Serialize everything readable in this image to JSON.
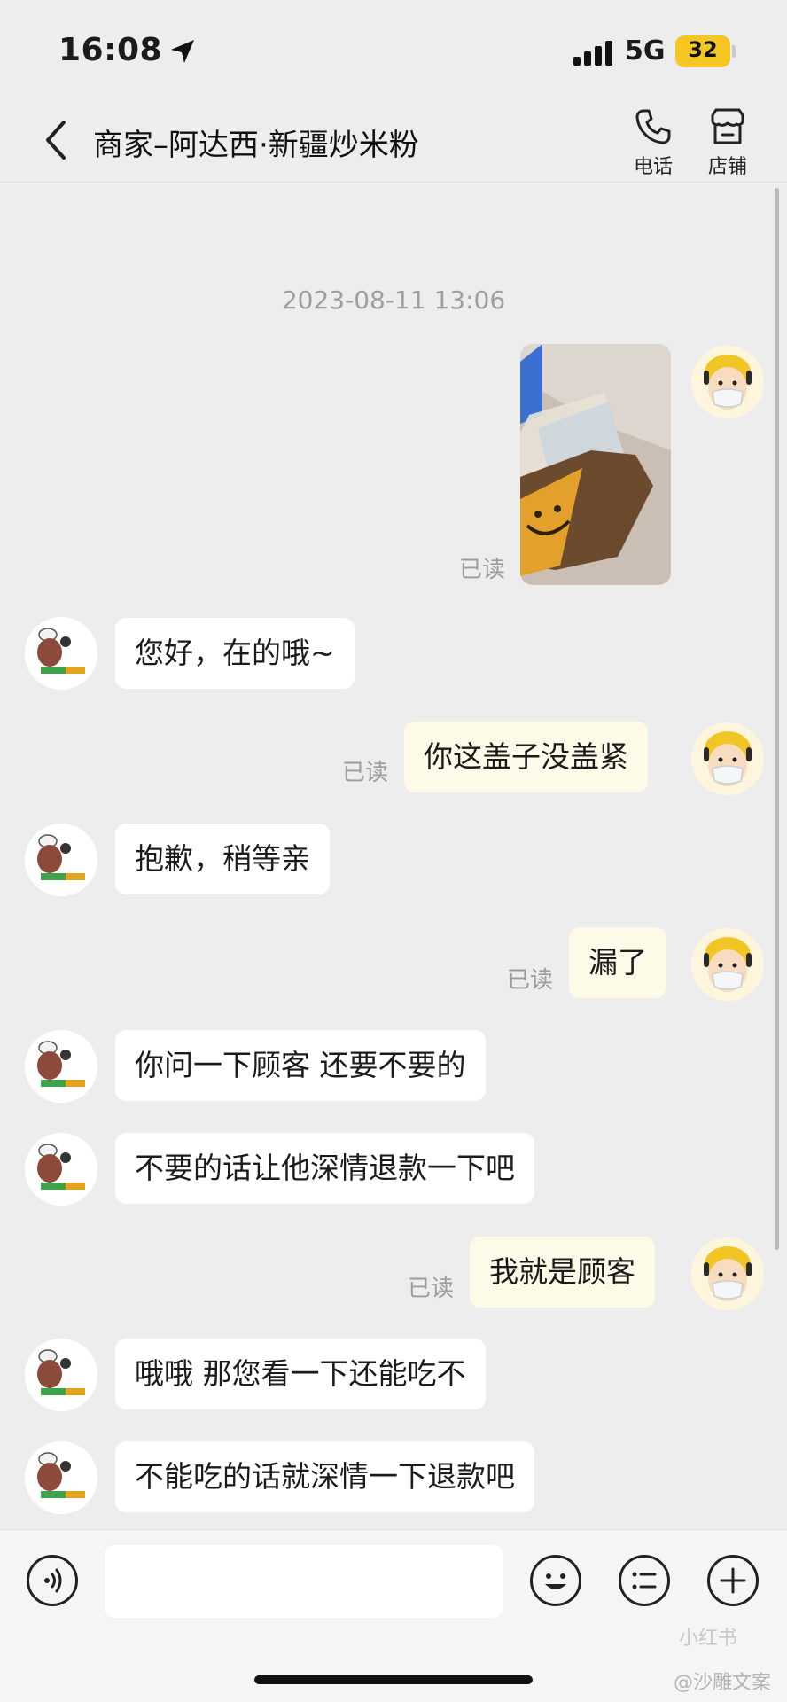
{
  "status_bar": {
    "time": "16:08",
    "network": "5G",
    "battery": "32"
  },
  "header": {
    "title": "商家–阿达西·新疆炒米粉",
    "phone_label": "电话",
    "store_label": "店铺"
  },
  "timestamp": "2023-08-11 13:06",
  "messages": [
    {
      "side": "right",
      "type": "image",
      "read": "已读"
    },
    {
      "side": "left",
      "text": "您好，在的哦~"
    },
    {
      "side": "right",
      "text": "你这盖子没盖紧",
      "read": "已读"
    },
    {
      "side": "left",
      "text": "抱歉，稍等亲"
    },
    {
      "side": "right",
      "text": "漏了",
      "read": "已读"
    },
    {
      "side": "left",
      "text": "你问一下顾客 还要不要的"
    },
    {
      "side": "left",
      "text": "不要的话让他深情退款一下吧"
    },
    {
      "side": "right",
      "text": "我就是顾客",
      "read": "已读"
    },
    {
      "side": "left",
      "text": "哦哦 那您看一下还能吃不"
    },
    {
      "side": "left",
      "text": "不能吃的话就深情一下退款吧"
    }
  ],
  "merchant_avatar": {
    "name": "阿达西",
    "sub": "新疆炒米粉"
  },
  "input": {
    "value": "",
    "placeholder": ""
  },
  "watermark": "@沙雕文案",
  "watermark_small": "小红书",
  "colors": {
    "sent_bubble": "#fefae8",
    "received_bubble": "#ffffff",
    "background": "#ededed",
    "battery": "#f6c623"
  },
  "icons": [
    "location-arrow-icon",
    "signal-icon",
    "back-icon",
    "phone-icon",
    "store-icon",
    "voice-icon",
    "emoji-icon",
    "list-icon",
    "plus-icon"
  ]
}
